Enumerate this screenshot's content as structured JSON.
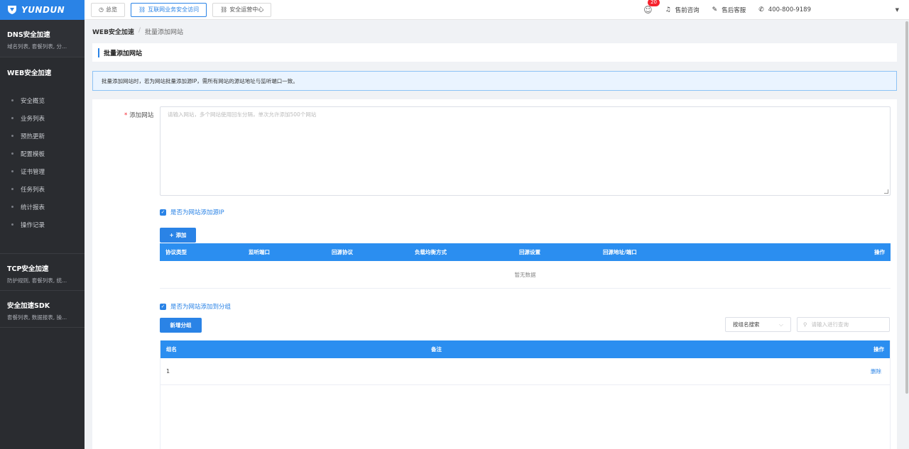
{
  "logo": {
    "text": "YUNDUN"
  },
  "sidebar": {
    "groups": [
      {
        "title": "DNS安全加速",
        "sub": "域名列表, 套餐列表, 分..."
      },
      {
        "title": "WEB安全加速"
      },
      {
        "title": "TCP安全加速",
        "sub": "防护规则, 套餐列表, 统..."
      },
      {
        "title": "安全加速SDK",
        "sub": "套餐列表, 数据报表, 操..."
      }
    ],
    "web_items": [
      "安全概览",
      "业务列表",
      "预热更新",
      "配置模板",
      "证书管理",
      "任务列表",
      "统计报表",
      "操作记录"
    ]
  },
  "topbar": {
    "tabs": [
      "总览",
      "互联网业务安全访问",
      "安全运营中心"
    ],
    "badge": "20",
    "presale": "售前咨询",
    "aftersale": "售后客服",
    "phone": "400-800-9189"
  },
  "breadcrumb": {
    "root": "WEB安全加速",
    "sep": "/",
    "current": "批量添加网站"
  },
  "page_title": "批量添加网站",
  "notice": "批量添加网站时，若为网站批量添加源IP，需所有网站的源站地址与监听端口一致。",
  "form": {
    "site_label": "添加网站",
    "site_placeholder": "请输入网站，多个网站使用回车分隔，单次允许添加500个网站",
    "source_ip_check": "是否为网站添加源IP",
    "add_button": "+ 添加",
    "source_table": {
      "headers": [
        "协议类型",
        "监听端口",
        "回源协议",
        "负载均衡方式",
        "回源设置",
        "回源地址/端口",
        "操作"
      ],
      "empty": "暂无数据"
    },
    "group_check": "是否为网站添加到分组",
    "new_group_button": "新增分组",
    "search_select": "按组名搜索",
    "search_placeholder": "请输入进行查询",
    "group_table": {
      "headers": [
        "组名",
        "备注",
        "操作"
      ],
      "rows": [
        {
          "name": "1",
          "action": "删除"
        }
      ]
    }
  },
  "colors": {
    "accent": "#2a83e6",
    "sidebar": "#2a2c30",
    "table_head": "#2b8ef0"
  }
}
